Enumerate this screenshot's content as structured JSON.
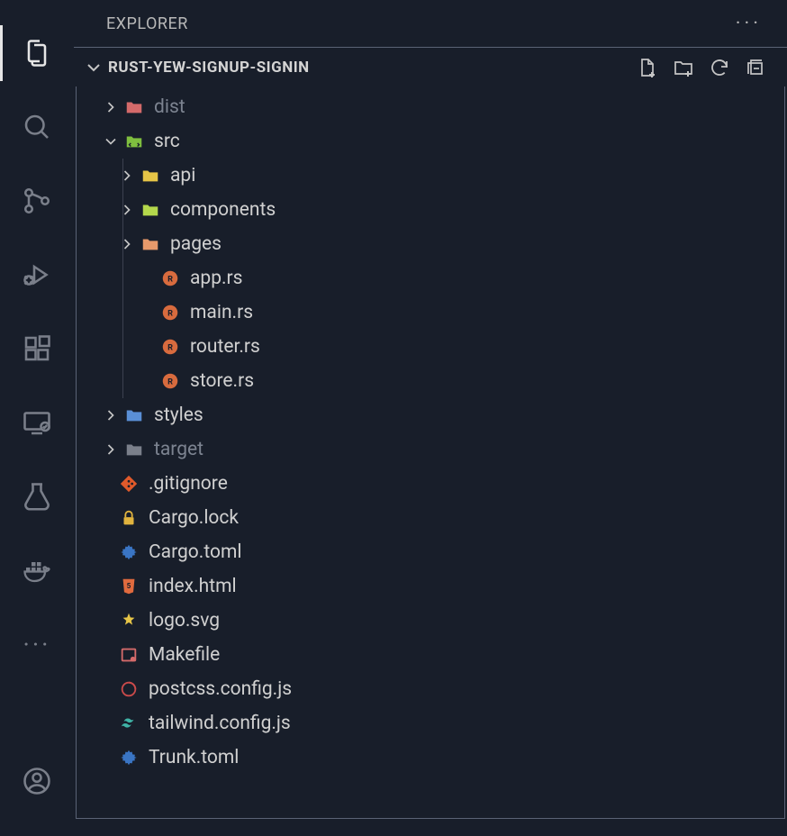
{
  "sidebar_title": "EXPLORER",
  "project_name": "RUST-YEW-SIGNUP-SIGNIN",
  "tree": {
    "dist": "dist",
    "src": "src",
    "api": "api",
    "components": "components",
    "pages": "pages",
    "app_rs": "app.rs",
    "main_rs": "main.rs",
    "router_rs": "router.rs",
    "store_rs": "store.rs",
    "styles": "styles",
    "target": "target",
    "gitignore": ".gitignore",
    "cargo_lock": "Cargo.lock",
    "cargo_toml": "Cargo.toml",
    "index_html": "index.html",
    "logo_svg": "logo.svg",
    "makefile": "Makefile",
    "postcss": "postcss.config.js",
    "tailwind": "tailwind.config.js",
    "trunk_toml": "Trunk.toml"
  }
}
